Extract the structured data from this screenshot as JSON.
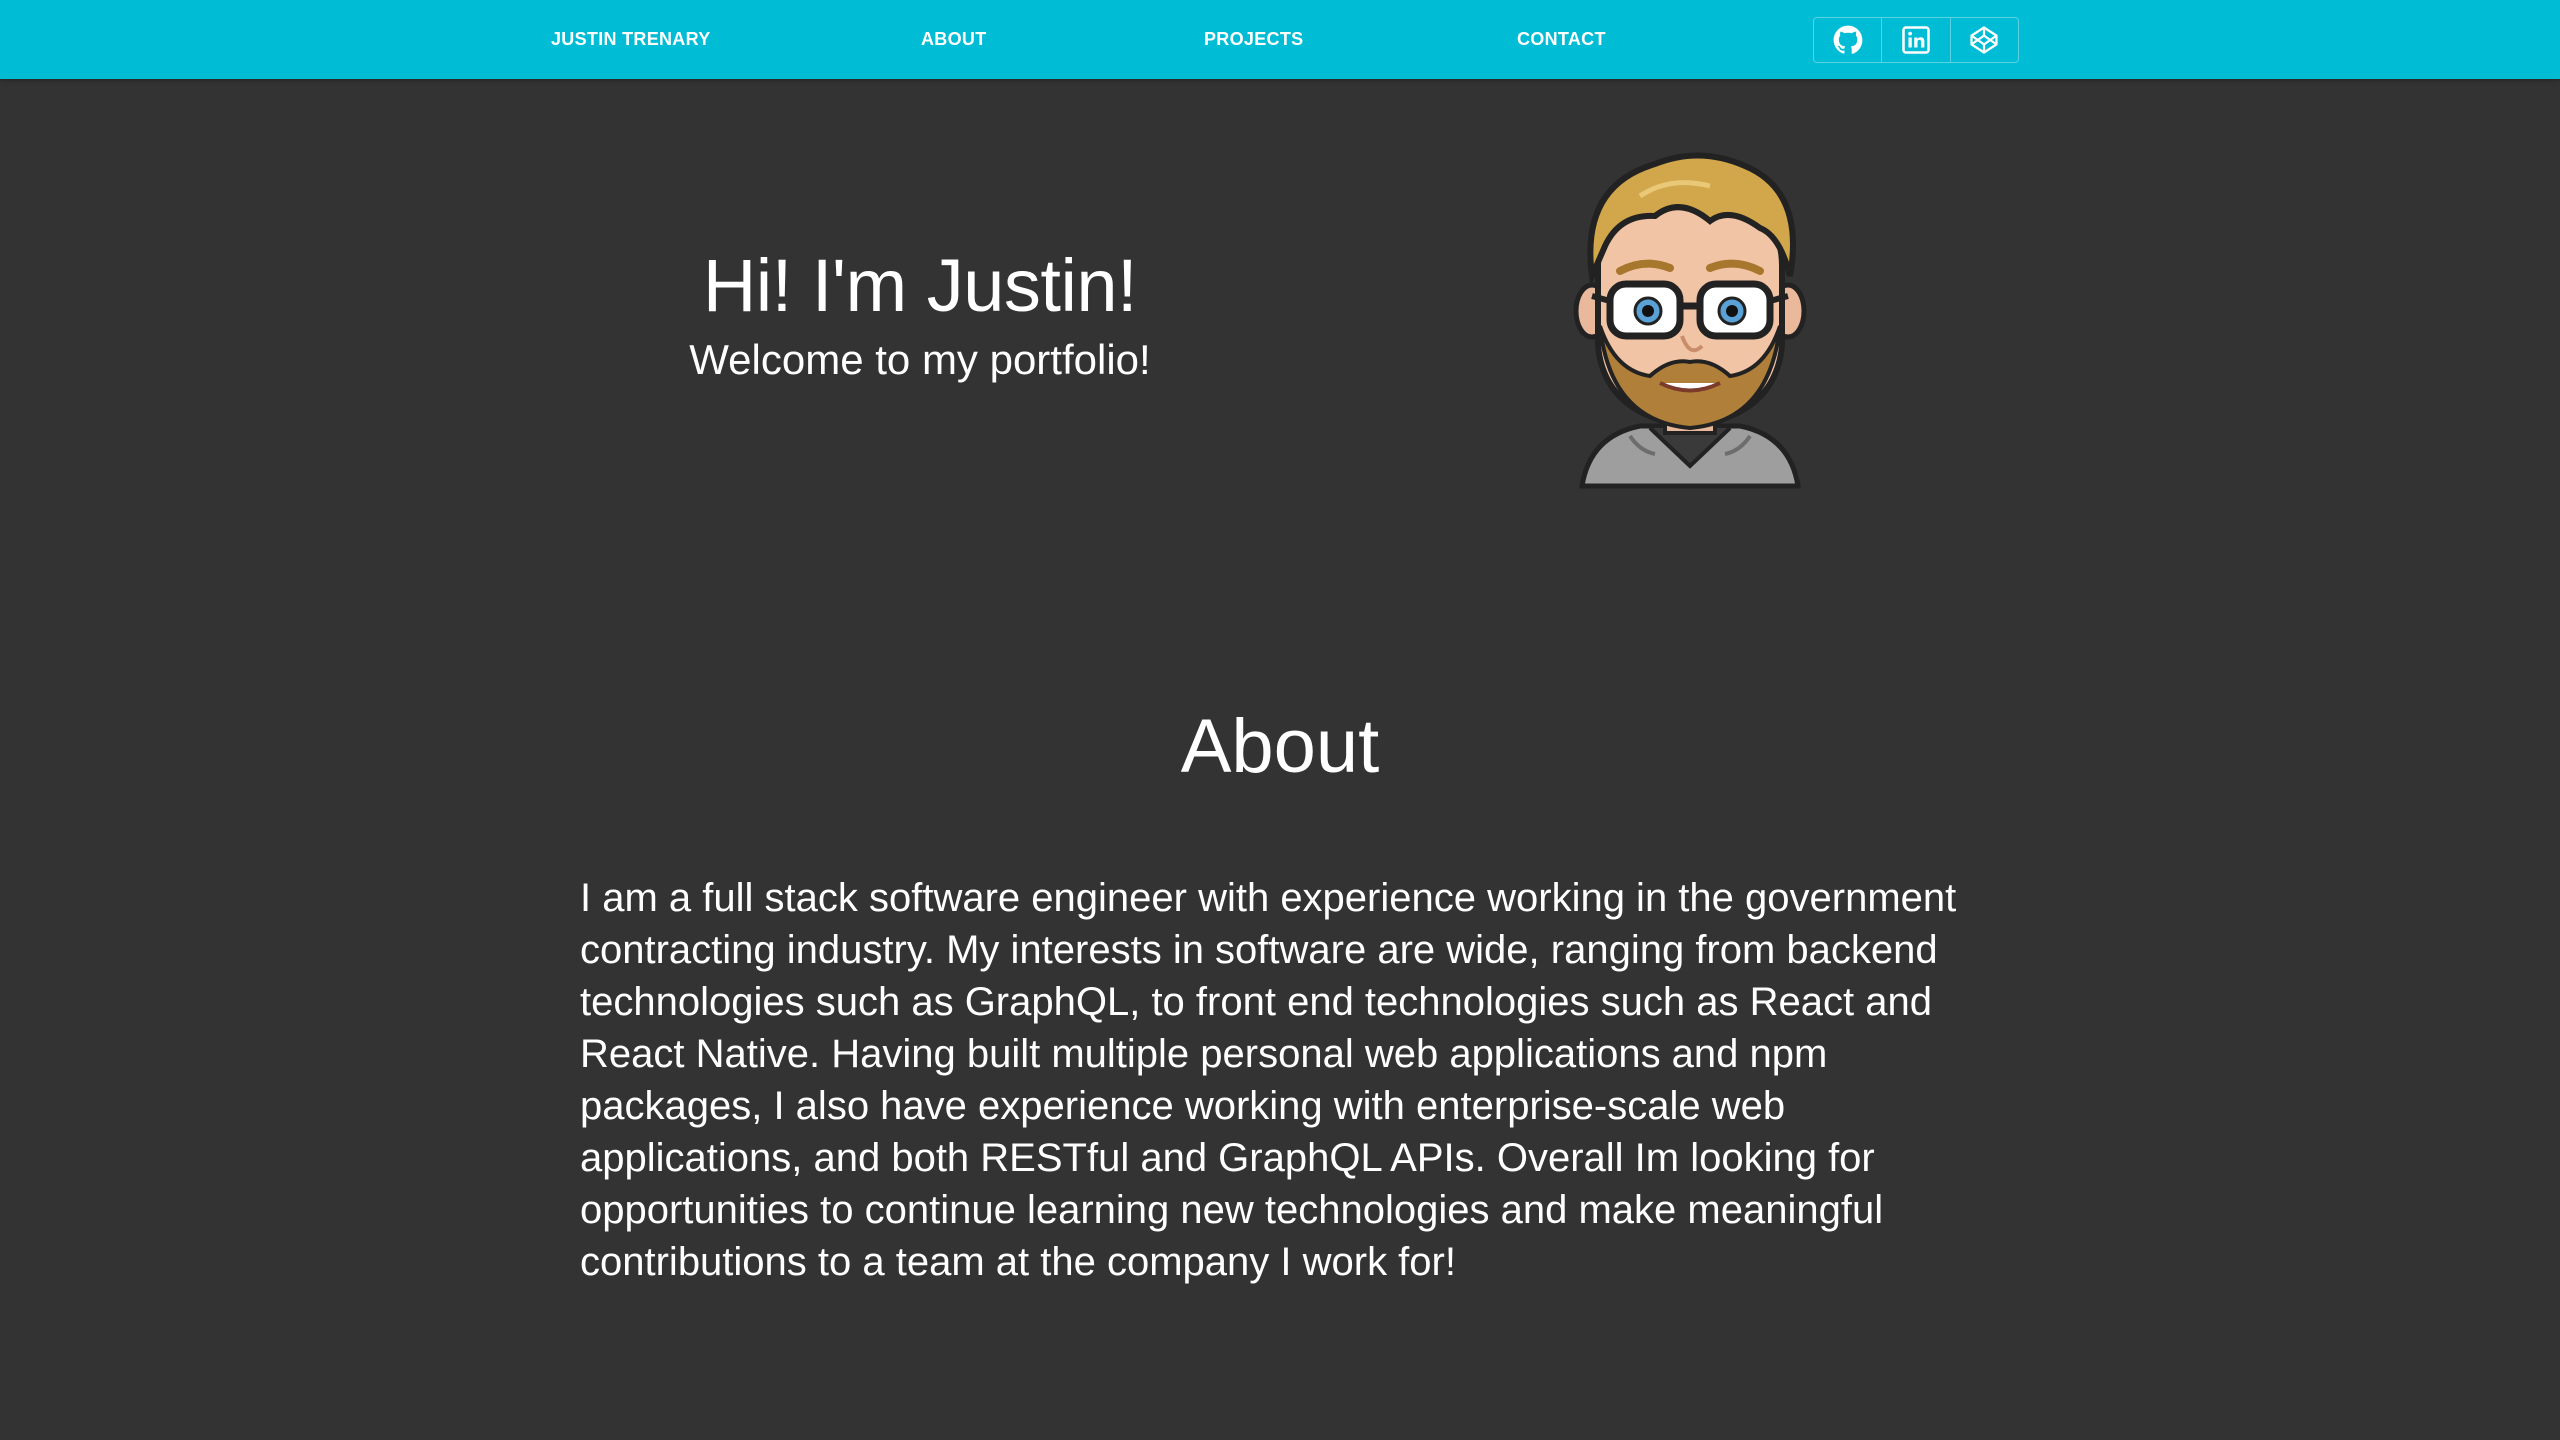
{
  "nav": {
    "brand": "JUSTIN TRENARY",
    "about": "ABOUT",
    "projects": "PROJECTS",
    "contact": "CONTACT",
    "social": [
      {
        "icon": "github-icon"
      },
      {
        "icon": "linkedin-icon"
      },
      {
        "icon": "codepen-icon"
      }
    ]
  },
  "hero": {
    "title": "Hi! I'm Justin!",
    "subtitle": "Welcome to my portfolio!"
  },
  "about": {
    "title": "About",
    "body": "I am a full stack software engineer with experience working in the government contracting industry. My interests in software are wide, ranging from backend technologies such as GraphQL, to front end technologies such as React and React Native. Having built multiple personal web applications and npm packages, I also have experience working with enterprise-scale web applications, and both RESTful and GraphQL APIs. Overall Im looking for opportunities to continue learning new technologies and make meaningful contributions to a team at the company I work for!"
  },
  "colors": {
    "navbar": "#00bcd4",
    "background": "#333333",
    "text": "#ffffff"
  }
}
